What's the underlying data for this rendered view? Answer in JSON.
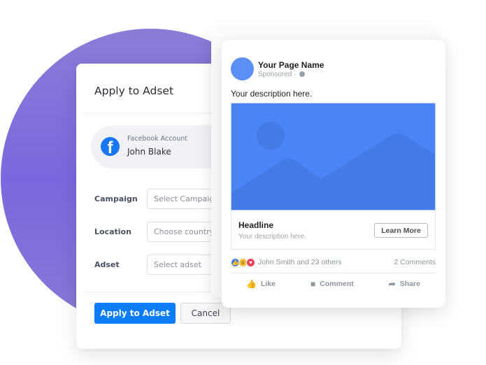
{
  "dialog": {
    "title": "Apply to Adset",
    "account": {
      "label": "Facebook Account",
      "name": "John Blake",
      "icon": "facebook-logo-icon",
      "icon_glyph": "f"
    },
    "fields": [
      {
        "label": "Campaign",
        "placeholder": "Select Campaign"
      },
      {
        "label": "Location",
        "placeholder": "Choose country"
      },
      {
        "label": "Adset",
        "placeholder": "Select adset"
      }
    ],
    "apply_label": "Apply to Adset",
    "cancel_label": "Cancel"
  },
  "post": {
    "page_name": "Your Page Name",
    "sponsored": "Sponsored ·",
    "description": "Your description here.",
    "headline": "Headline",
    "link_description": "Your description here.",
    "cta_label": "Learn More",
    "reactions_text": "John Smith and 23 others",
    "comments_count": "2 Comments",
    "reaction_icons": [
      "like-reaction-icon",
      "wow-reaction-icon",
      "love-reaction-icon"
    ],
    "actions": [
      {
        "label": "Like",
        "icon": "thumbs-up-icon",
        "glyph": "👍"
      },
      {
        "label": "Comment",
        "icon": "comment-icon",
        "glyph": "■"
      },
      {
        "label": "Share",
        "icon": "share-icon",
        "glyph": "➦"
      }
    ]
  },
  "colors": {
    "primary": "#0a7cff",
    "facebook": "#1877f2",
    "image_placeholder": "#4a84f5",
    "bg_circle": "#7b68e0"
  }
}
